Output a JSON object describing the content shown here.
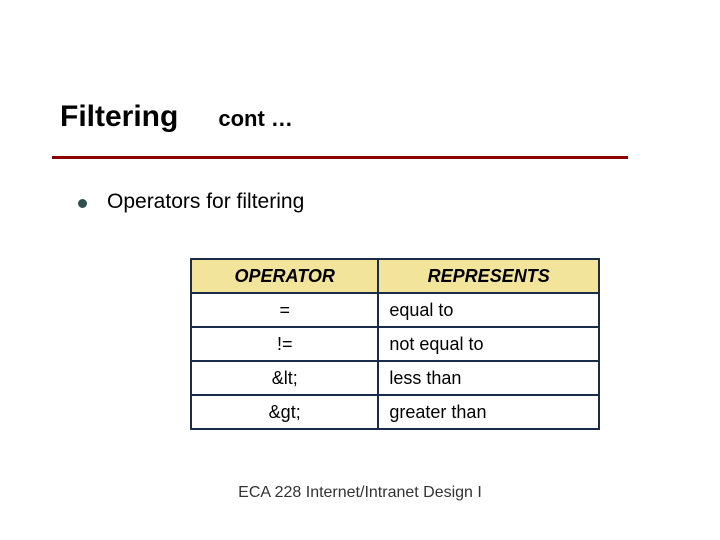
{
  "title": {
    "main": "Filtering",
    "sub": "cont …"
  },
  "bullet": {
    "text": "Operators for filtering"
  },
  "table": {
    "headers": {
      "col1": "OPERATOR",
      "col2": "REPRESENTS"
    },
    "rows": [
      {
        "operator": "=",
        "represents": "equal to"
      },
      {
        "operator": "!=",
        "represents": "not equal to"
      },
      {
        "operator": "&lt;",
        "represents": "less than"
      },
      {
        "operator": "&gt;",
        "represents": "greater than"
      }
    ]
  },
  "footer": {
    "text": "ECA 228  Internet/Intranet Design I"
  }
}
